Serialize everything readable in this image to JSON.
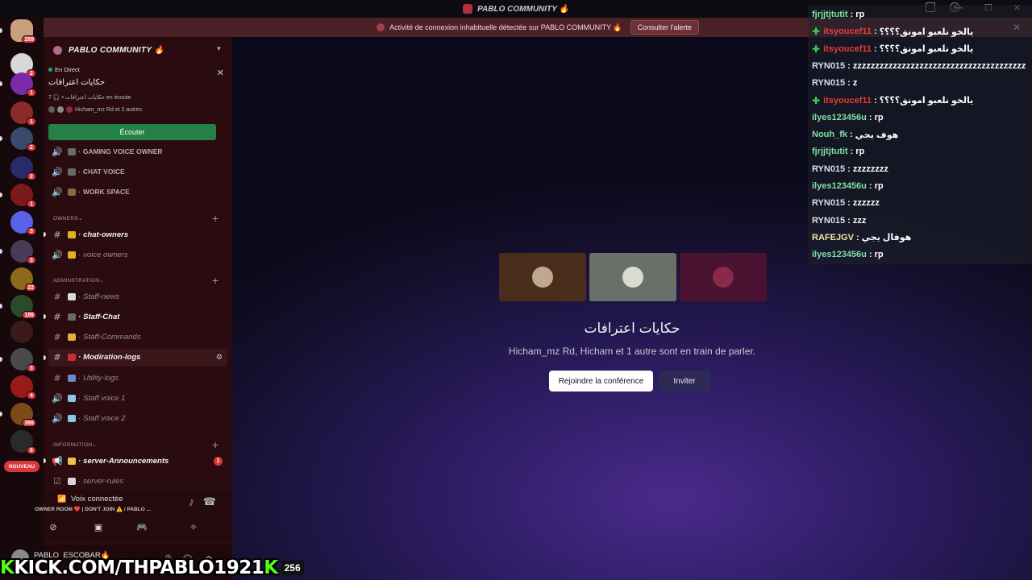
{
  "titlebar": {
    "title": "PABLO COMMUNITY 🔥"
  },
  "alert": {
    "message": "Activité de connexion inhabituelle détectée sur PABLO COMMUNITY 🔥",
    "button": "Consulter l'alerte"
  },
  "rail": {
    "servers": [
      {
        "badge": "289",
        "color": "#c8a07a"
      },
      {
        "badge": "2",
        "color": "#d8d8d8"
      },
      {
        "badge": "1",
        "color": "#7a2aa8"
      },
      {
        "badge": "1",
        "color": "#8a2a2a"
      },
      {
        "badge": "2",
        "color": "#3a4a6a"
      },
      {
        "badge": "2",
        "color": "#2a2a6a"
      },
      {
        "badge": "1",
        "color": "#7a1a1a"
      },
      {
        "badge": "3",
        "color": "#5a62e8"
      },
      {
        "badge": "3",
        "color": "#4a3a5a"
      },
      {
        "badge": "22",
        "color": "#8a6a1a"
      },
      {
        "badge": "186",
        "color": "#2a4a2a"
      },
      {
        "badge": "",
        "color": "#3a1a1a"
      },
      {
        "badge": "3",
        "color": "#4a4a4a"
      },
      {
        "badge": "4",
        "color": "#9a1a1a"
      },
      {
        "badge": "386",
        "color": "#7a4a1a"
      },
      {
        "badge": "6",
        "color": "#2a2a2a"
      }
    ],
    "new_label": "NOUVEAU"
  },
  "sidebar": {
    "server_name": "PABLO COMMUNITY 🔥",
    "live": {
      "status": "En Direct",
      "stage_title": "حكايات اعترافات",
      "meta": "حكايات اعترافات • 🎧 7 en écoute",
      "speakers": "Hicham_mz Rd et 2 autres",
      "listen_button": "Écouter"
    },
    "voice_channels": [
      {
        "name": "GAMING VOICE OWNER",
        "emoji_color": "#6a6a6a"
      },
      {
        "name": "CHAT VOICE",
        "emoji_color": "#6a6a6a"
      },
      {
        "name": "WORK SPACE",
        "emoji_color": "#8a6a4a"
      }
    ],
    "categories": {
      "owners": "OWNERS",
      "administration": "ADMINSTRATION",
      "information": "INFORMATION"
    },
    "owners_channels": [
      {
        "type": "#",
        "name": "chat-owners",
        "emoji_color": "#e0b020",
        "unread": true
      },
      {
        "type": "🔊",
        "name": "voice owners",
        "emoji_color": "#e0b020",
        "unread": false
      }
    ],
    "admin_channels": [
      {
        "type": "#",
        "name": "Staff-news",
        "emoji_color": "#d8d8d8",
        "unread": false
      },
      {
        "type": "#",
        "name": "Staff-Chat",
        "emoji_color": "#6a6a6a",
        "unread": true
      },
      {
        "type": "#",
        "name": "Staff-Commands",
        "emoji_color": "#e0b040",
        "unread": false
      },
      {
        "type": "#",
        "name": "Modiration-logs",
        "emoji_color": "#c83030",
        "unread": true
      },
      {
        "type": "#",
        "name": "Utility-logs",
        "emoji_color": "#6a8ac8",
        "unread": false
      },
      {
        "type": "🔊",
        "name": "Staff voice 1",
        "emoji_color": "#8ac8e8",
        "unread": false
      },
      {
        "type": "🔊",
        "name": "Staff voice 2",
        "emoji_color": "#8ac8e8",
        "unread": false
      }
    ],
    "info_channels": [
      {
        "type": "📢",
        "name": "server-Announcements",
        "emoji_color": "#f0c040",
        "unread": true,
        "mentions": "1"
      },
      {
        "type": "☑",
        "name": "server-rules",
        "emoji_color": "#d8d8d8",
        "unread": false
      }
    ],
    "voice_panel": {
      "title": "Voix connectée",
      "subtitle": "OWNER ROOM ❤️  |  DON'T JOIN ⚠️ / PABLO ..."
    },
    "user": {
      "name": "PABLO_ESCOBAR🔥"
    }
  },
  "stage": {
    "name": "حكايات اعترافات",
    "subtitle": "Hicham_mz Rd, Hicham et 1 autre sont en train de parler.",
    "join_button": "Rejoindre la conférence",
    "invite_button": "Inviter",
    "tiles": [
      {
        "bg": "#4a2e1c",
        "avatar": "#c0a890"
      },
      {
        "bg": "#6a7068",
        "avatar": "#d8dcd0"
      },
      {
        "bg": "#4a1230",
        "avatar": "#8a2a4a"
      }
    ]
  },
  "chat": {
    "messages": [
      {
        "user": "fjrjjtjtutit",
        "text": "rp",
        "color": "#7fe0a8",
        "plus": false
      },
      {
        "user": "itsyoucef11",
        "text": "يالخو نلعبو امونق؟؟؟؟",
        "color": "#e83a3a",
        "plus": true
      },
      {
        "user": "itsyoucef11",
        "text": "يالخو نلعبو امونق؟؟؟؟",
        "color": "#e83a3a",
        "plus": true
      },
      {
        "user": "RYN015",
        "text": "zzzzzzzzzzzzzzzzzzzzzzzzzzzzzzzzzzzzzzz",
        "color": "#d8e0e8",
        "plus": false
      },
      {
        "user": "RYN015",
        "text": "z",
        "color": "#d8e0e8",
        "plus": false
      },
      {
        "user": "itsyoucef11",
        "text": "يالخو نلعبو امونق؟؟؟؟",
        "color": "#e83a3a",
        "plus": true
      },
      {
        "user": "ilyes123456u",
        "text": "rp",
        "color": "#7fe0a8",
        "plus": false
      },
      {
        "user": "Nouh_fk",
        "text": "هوف يجي",
        "color": "#7fe0a8",
        "plus": false
      },
      {
        "user": "fjrjjtjtutit",
        "text": "rp",
        "color": "#7fe0a8",
        "plus": false
      },
      {
        "user": "RYN015",
        "text": "zzzzzzzz",
        "color": "#d8e0e8",
        "plus": false
      },
      {
        "user": "ilyes123456u",
        "text": "rp",
        "color": "#7fe0a8",
        "plus": false
      },
      {
        "user": "RYN015",
        "text": "zzzzzz",
        "color": "#d8e0e8",
        "plus": false
      },
      {
        "user": "RYN015",
        "text": "zzz",
        "color": "#d8e0e8",
        "plus": false
      },
      {
        "user": "RAFEJGV",
        "text": "هوفال يجي",
        "color": "#f0e6a8",
        "plus": false
      },
      {
        "user": "ilyes123456u",
        "text": "rp",
        "color": "#7fe0a8",
        "plus": false
      }
    ]
  },
  "watermark": {
    "prefix": "K",
    "url": "KICK.COM/THPABLO1921",
    "suffix": "K",
    "viewers": "256"
  }
}
